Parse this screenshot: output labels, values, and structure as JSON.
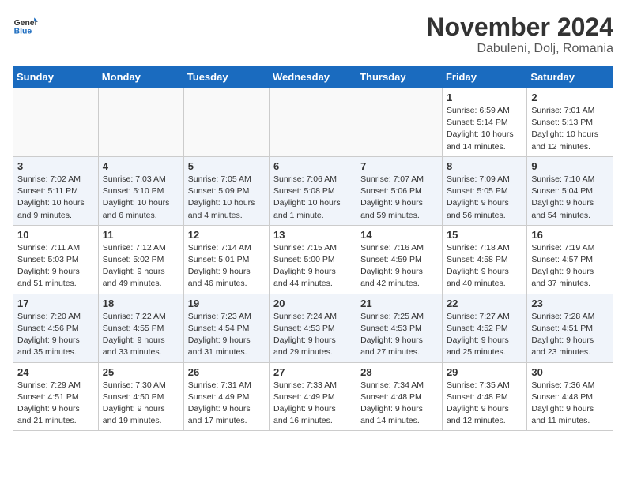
{
  "header": {
    "logo_general": "General",
    "logo_blue": "Blue",
    "month_title": "November 2024",
    "location": "Dabuleni, Dolj, Romania"
  },
  "weekdays": [
    "Sunday",
    "Monday",
    "Tuesday",
    "Wednesday",
    "Thursday",
    "Friday",
    "Saturday"
  ],
  "weeks": [
    [
      {
        "day": "",
        "info": ""
      },
      {
        "day": "",
        "info": ""
      },
      {
        "day": "",
        "info": ""
      },
      {
        "day": "",
        "info": ""
      },
      {
        "day": "",
        "info": ""
      },
      {
        "day": "1",
        "info": "Sunrise: 6:59 AM\nSunset: 5:14 PM\nDaylight: 10 hours and 14 minutes."
      },
      {
        "day": "2",
        "info": "Sunrise: 7:01 AM\nSunset: 5:13 PM\nDaylight: 10 hours and 12 minutes."
      }
    ],
    [
      {
        "day": "3",
        "info": "Sunrise: 7:02 AM\nSunset: 5:11 PM\nDaylight: 10 hours and 9 minutes."
      },
      {
        "day": "4",
        "info": "Sunrise: 7:03 AM\nSunset: 5:10 PM\nDaylight: 10 hours and 6 minutes."
      },
      {
        "day": "5",
        "info": "Sunrise: 7:05 AM\nSunset: 5:09 PM\nDaylight: 10 hours and 4 minutes."
      },
      {
        "day": "6",
        "info": "Sunrise: 7:06 AM\nSunset: 5:08 PM\nDaylight: 10 hours and 1 minute."
      },
      {
        "day": "7",
        "info": "Sunrise: 7:07 AM\nSunset: 5:06 PM\nDaylight: 9 hours and 59 minutes."
      },
      {
        "day": "8",
        "info": "Sunrise: 7:09 AM\nSunset: 5:05 PM\nDaylight: 9 hours and 56 minutes."
      },
      {
        "day": "9",
        "info": "Sunrise: 7:10 AM\nSunset: 5:04 PM\nDaylight: 9 hours and 54 minutes."
      }
    ],
    [
      {
        "day": "10",
        "info": "Sunrise: 7:11 AM\nSunset: 5:03 PM\nDaylight: 9 hours and 51 minutes."
      },
      {
        "day": "11",
        "info": "Sunrise: 7:12 AM\nSunset: 5:02 PM\nDaylight: 9 hours and 49 minutes."
      },
      {
        "day": "12",
        "info": "Sunrise: 7:14 AM\nSunset: 5:01 PM\nDaylight: 9 hours and 46 minutes."
      },
      {
        "day": "13",
        "info": "Sunrise: 7:15 AM\nSunset: 5:00 PM\nDaylight: 9 hours and 44 minutes."
      },
      {
        "day": "14",
        "info": "Sunrise: 7:16 AM\nSunset: 4:59 PM\nDaylight: 9 hours and 42 minutes."
      },
      {
        "day": "15",
        "info": "Sunrise: 7:18 AM\nSunset: 4:58 PM\nDaylight: 9 hours and 40 minutes."
      },
      {
        "day": "16",
        "info": "Sunrise: 7:19 AM\nSunset: 4:57 PM\nDaylight: 9 hours and 37 minutes."
      }
    ],
    [
      {
        "day": "17",
        "info": "Sunrise: 7:20 AM\nSunset: 4:56 PM\nDaylight: 9 hours and 35 minutes."
      },
      {
        "day": "18",
        "info": "Sunrise: 7:22 AM\nSunset: 4:55 PM\nDaylight: 9 hours and 33 minutes."
      },
      {
        "day": "19",
        "info": "Sunrise: 7:23 AM\nSunset: 4:54 PM\nDaylight: 9 hours and 31 minutes."
      },
      {
        "day": "20",
        "info": "Sunrise: 7:24 AM\nSunset: 4:53 PM\nDaylight: 9 hours and 29 minutes."
      },
      {
        "day": "21",
        "info": "Sunrise: 7:25 AM\nSunset: 4:53 PM\nDaylight: 9 hours and 27 minutes."
      },
      {
        "day": "22",
        "info": "Sunrise: 7:27 AM\nSunset: 4:52 PM\nDaylight: 9 hours and 25 minutes."
      },
      {
        "day": "23",
        "info": "Sunrise: 7:28 AM\nSunset: 4:51 PM\nDaylight: 9 hours and 23 minutes."
      }
    ],
    [
      {
        "day": "24",
        "info": "Sunrise: 7:29 AM\nSunset: 4:51 PM\nDaylight: 9 hours and 21 minutes."
      },
      {
        "day": "25",
        "info": "Sunrise: 7:30 AM\nSunset: 4:50 PM\nDaylight: 9 hours and 19 minutes."
      },
      {
        "day": "26",
        "info": "Sunrise: 7:31 AM\nSunset: 4:49 PM\nDaylight: 9 hours and 17 minutes."
      },
      {
        "day": "27",
        "info": "Sunrise: 7:33 AM\nSunset: 4:49 PM\nDaylight: 9 hours and 16 minutes."
      },
      {
        "day": "28",
        "info": "Sunrise: 7:34 AM\nSunset: 4:48 PM\nDaylight: 9 hours and 14 minutes."
      },
      {
        "day": "29",
        "info": "Sunrise: 7:35 AM\nSunset: 4:48 PM\nDaylight: 9 hours and 12 minutes."
      },
      {
        "day": "30",
        "info": "Sunrise: 7:36 AM\nSunset: 4:48 PM\nDaylight: 9 hours and 11 minutes."
      }
    ]
  ]
}
